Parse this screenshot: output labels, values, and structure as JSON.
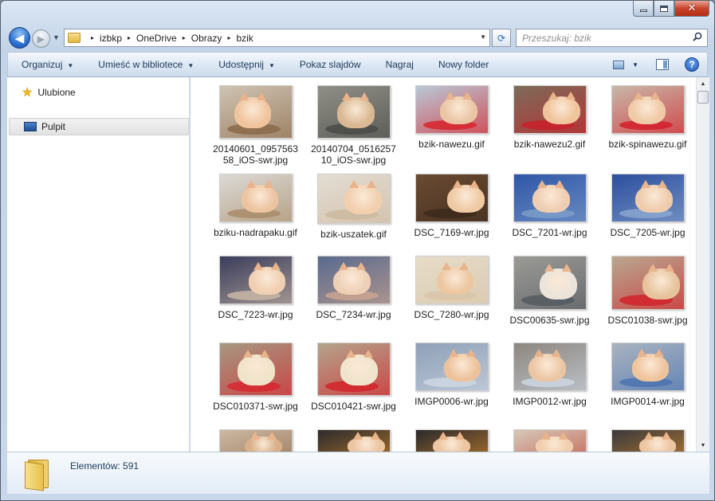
{
  "window": {
    "caption_close": "✕"
  },
  "nav": {
    "back_glyph": "◀",
    "forward_glyph": "▶",
    "recent_glyph": "▼"
  },
  "address": {
    "sep": "▸",
    "crumbs": [
      "izbkp",
      "OneDrive",
      "Obrazy",
      "bzik"
    ],
    "dropdown_glyph": "▼",
    "refresh_glyph": "⟳"
  },
  "search": {
    "placeholder": "Przeszukaj: bzik",
    "icon": "magnifier-icon"
  },
  "toolbar": {
    "organize": "Organizuj",
    "include_in_library": "Umieść w bibliotece",
    "share": "Udostępnij",
    "slideshow": "Pokaz slajdów",
    "burn": "Nagraj",
    "new_folder": "Nowy folder",
    "dropdown_glyph": "▼",
    "help_glyph": "?"
  },
  "navpane": {
    "favorites": "Ulubione",
    "desktop": "Pulpit",
    "star_glyph": "★"
  },
  "files": [
    {
      "name": "20140601_095756358_iOS-swr.jpg",
      "bg": "#cfc3b2",
      "cat": "#f0c49d",
      "prop": "#8a6a4a"
    },
    {
      "name": "20140704_051625710_iOS-swr.jpg",
      "bg": "#8f8f86",
      "cat": "#d9b893",
      "prop": "#4a4a48"
    },
    {
      "name": "bzik-nawezu.gif",
      "bg": "#b9c8d6",
      "cat": "#eac6a4",
      "prop": "#d8232b"
    },
    {
      "name": "bzik-nawezu2.gif",
      "bg": "#7d6b59",
      "cat": "#efc39b",
      "prop": "#c9202a"
    },
    {
      "name": "bzik-spinawezu.gif",
      "bg": "#c8b8a8",
      "cat": "#efcaa6",
      "prop": "#d41f2b"
    },
    {
      "name": "bziku-nadrapaku.gif",
      "bg": "#dcdad6",
      "cat": "#ecc4a0",
      "prop": "#a88c68"
    },
    {
      "name": "bzik-uszatek.gif",
      "bg": "#e3ddd3",
      "cat": "#f2cfae",
      "prop": "#cdb9a0"
    },
    {
      "name": "DSC_7169-wr.jpg",
      "bg": "#6a4a32",
      "cat": "#efc9a4",
      "prop": "#3c2a1c"
    },
    {
      "name": "DSC_7201-wr.jpg",
      "bg": "#2f57a8",
      "cat": "#efcdb0",
      "prop": "#7d9cc9"
    },
    {
      "name": "DSC_7205-wr.jpg",
      "bg": "#2c4f9e",
      "cat": "#efcbac",
      "prop": "#8aa6cf"
    },
    {
      "name": "DSC_7223-wr.jpg",
      "bg": "#3a3d5c",
      "cat": "#f0cfb2",
      "prop": "#c9b7a6"
    },
    {
      "name": "DSC_7234-wr.jpg",
      "bg": "#5a6a8e",
      "cat": "#eed0b6",
      "prop": "#c9a48f"
    },
    {
      "name": "DSC_7280-wr.jpg",
      "bg": "#e6dcc9",
      "cat": "#ecc7a1",
      "prop": "#d8c5a8"
    },
    {
      "name": "DSC00635-swr.jpg",
      "bg": "#9b9a96",
      "cat": "#ebe4da",
      "prop": "#555a60"
    },
    {
      "name": "DSC01038-swr.jpg",
      "bg": "#b8a890",
      "cat": "#e7c39c",
      "prop": "#d1232c"
    },
    {
      "name": "DSC010371-swr.jpg",
      "bg": "#a69881",
      "cat": "#efe3c9",
      "prop": "#d72730"
    },
    {
      "name": "DSC010421-swr.jpg",
      "bg": "#b4a48c",
      "cat": "#f0e4cc",
      "prop": "#d3232b"
    },
    {
      "name": "IMGP0006-wr.jpg",
      "bg": "#8ea0b8",
      "cat": "#ecc29a",
      "prop": "#ced7e2"
    },
    {
      "name": "IMGP0012-wr.jpg",
      "bg": "#8c8680",
      "cat": "#ecc6a3",
      "prop": "#cdd6e0"
    },
    {
      "name": "IMGP0014-wr.jpg",
      "bg": "#a9b3c0",
      "cat": "#eec49c",
      "prop": "#4b73b0"
    },
    {
      "name": "",
      "bg": "#cdb8a2",
      "cat": "#d9b08a",
      "prop": "#8c6c4c"
    },
    {
      "name": "",
      "bg": "#2b2a2c",
      "cat": "#ecc6a2",
      "prop": "#d98a2c"
    },
    {
      "name": "",
      "bg": "#2b2a2c",
      "cat": "#ecc6a2",
      "prop": "#d98a2c"
    },
    {
      "name": "",
      "bg": "#d5c8b8",
      "cat": "#f1cfae",
      "prop": "#c24a3a"
    },
    {
      "name": "",
      "bg": "#3a3a3c",
      "cat": "#ecc6a2",
      "prop": "#d98a2c"
    }
  ],
  "scrollbar": {
    "up_glyph": "▲",
    "down_glyph": "▼"
  },
  "details": {
    "count": "Elementów: 591"
  }
}
